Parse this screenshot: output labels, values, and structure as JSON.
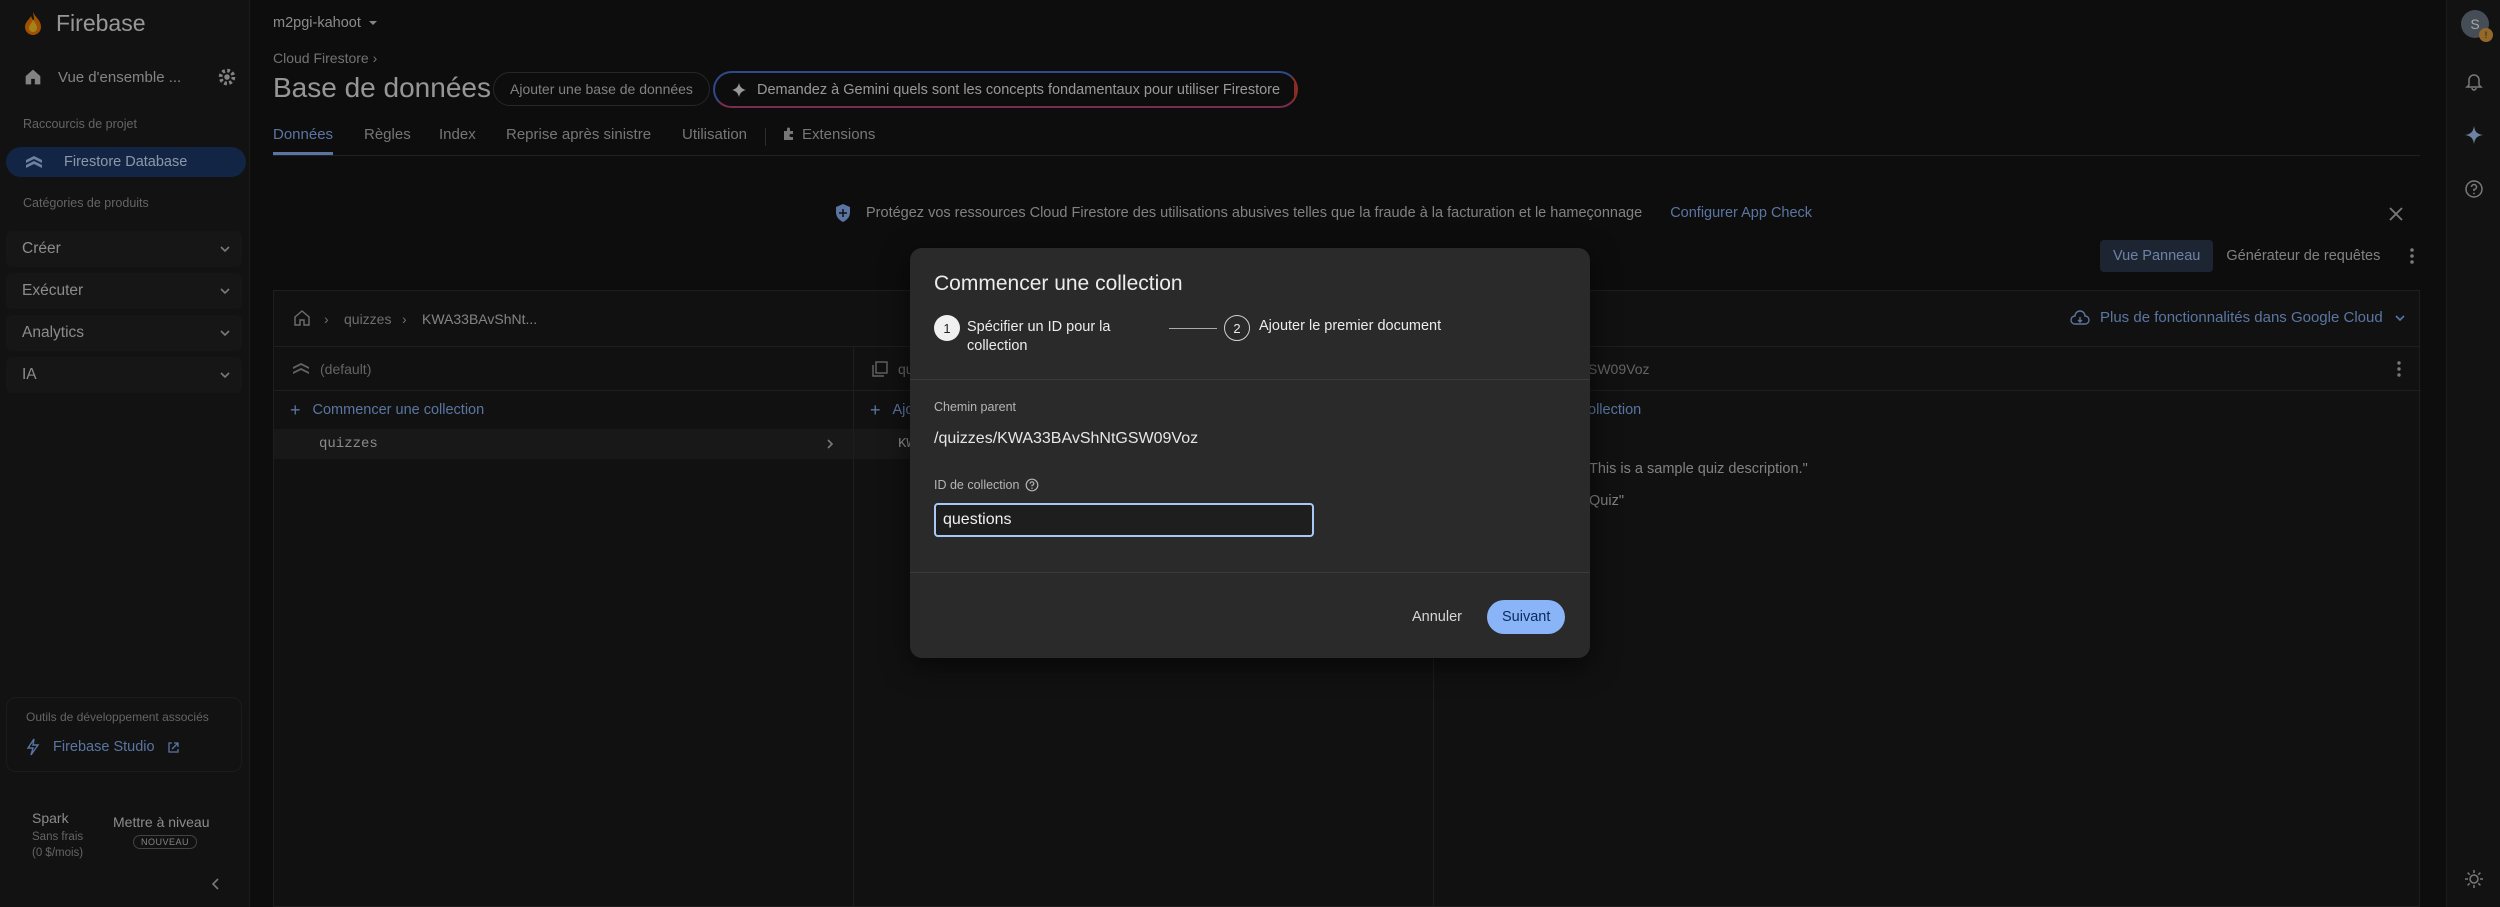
{
  "brand": "Firebase",
  "sidebar": {
    "overview_label": "Vue d'ensemble ...",
    "shortcuts_label": "Raccourcis de projet",
    "firestore_item": "Firestore Database",
    "categories_label": "Catégories de produits",
    "categories": [
      "Créer",
      "Exécuter",
      "Analytics",
      "IA"
    ],
    "devtools_label": "Outils de développement associés",
    "studio_link": "Firebase Studio",
    "plan_name": "Spark",
    "plan_price": "Sans frais (0 $/mois)",
    "upgrade": "Mettre à niveau",
    "new_badge": "NOUVEAU"
  },
  "rail": {
    "avatar_letter": "S"
  },
  "header": {
    "project": "m2pgi-kahoot",
    "breadcrumb": "Cloud Firestore",
    "title": "Base de données",
    "add_db": "Ajouter une base de données",
    "gemini_prompt": "Demandez à Gemini quels sont les concepts fondamentaux pour utiliser Firestore"
  },
  "tabs": [
    "Données",
    "Règles",
    "Index",
    "Reprise après sinistre",
    "Utilisation",
    "Extensions"
  ],
  "notice": {
    "text": "Protégez vos ressources Cloud Firestore des utilisations abusives telles que la fraude à la facturation et le hameçonnage",
    "link": "Configurer App Check"
  },
  "view": {
    "panel": "Vue Panneau",
    "query": "Générateur de requêtes"
  },
  "data_panel": {
    "path": [
      "quizzes",
      "KWA33BAvShNt..."
    ],
    "google_cloud": "Plus de fonctionnalités dans Google Cloud",
    "col1_head": "(default)",
    "col1_add": "Commencer une collection",
    "col1_row": "quizzes",
    "col2_head": "qu",
    "col2_add": "Ajo",
    "col2_row": "KW",
    "col3_head": "SW09Voz",
    "col3_add": "ollection",
    "col3_line1": "This is a sample quiz description.\"",
    "col3_line2": "Quiz\""
  },
  "dialog": {
    "title": "Commencer une collection",
    "step1_num": "1",
    "step1_label": "Spécifier un ID pour la collection",
    "step2_num": "2",
    "step2_label": "Ajouter le premier document",
    "parent_label": "Chemin parent",
    "parent_value": "/quizzes/KWA33BAvShNtGSW09Voz",
    "id_label": "ID de collection",
    "id_value": "questions",
    "cancel": "Annuler",
    "next": "Suivant"
  },
  "colors": {
    "accent": "#8ab4f8",
    "active_nav": "#1d3a6b",
    "gemini_border_left": "#4b6fd8",
    "gemini_border_right": "#d9453b"
  }
}
